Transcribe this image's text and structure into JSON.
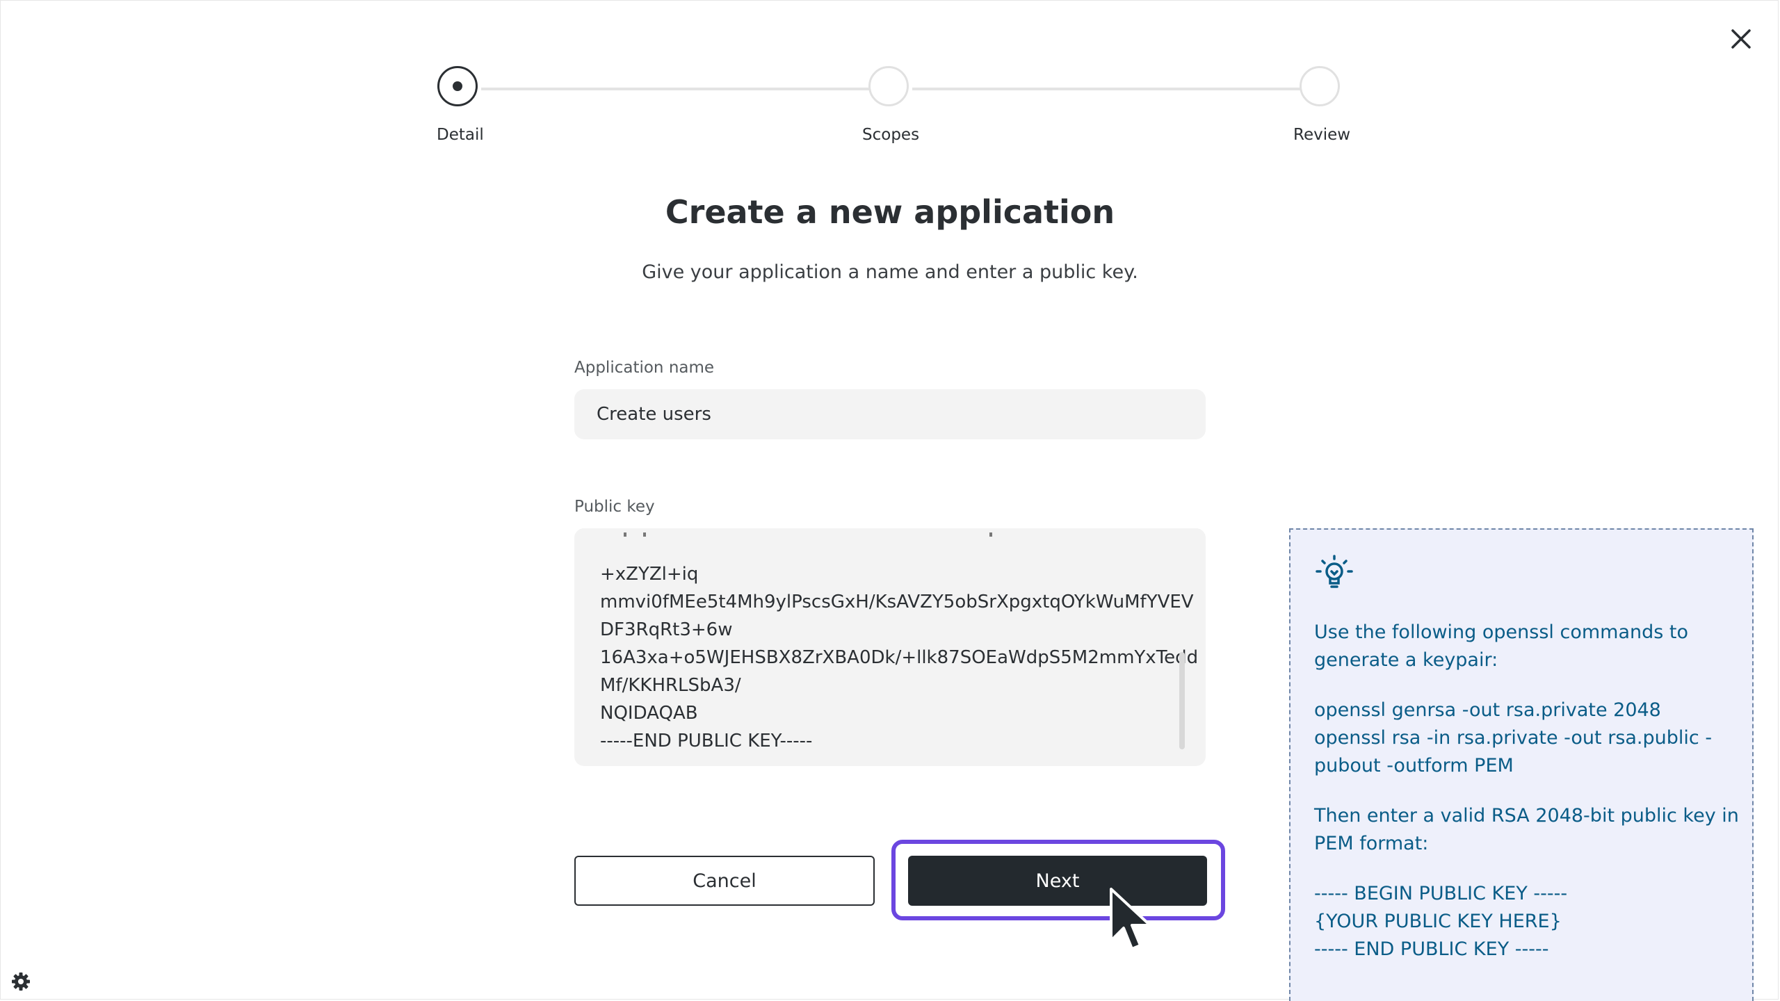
{
  "stepper": {
    "steps": [
      {
        "label": "Detail",
        "state": "active"
      },
      {
        "label": "Scopes",
        "state": "inactive"
      },
      {
        "label": "Review",
        "state": "inactive"
      }
    ]
  },
  "header": {
    "title": "Create a new application",
    "subtitle": "Give your application a name and enter a public key."
  },
  "form": {
    "app_name_label": "Application name",
    "app_name_value": "Create users",
    "public_key_label": "Public key",
    "public_key_lines": [
      "+xZYZl+iq",
      "mmvi0fMEe5t4Mh9ylPscsGxH/KsAVZY5obSrXpgxtqOYkWuMfYVEV",
      "DF3RqRt3+6w",
      "16A3xa+o5WJEHSBX8ZrXBA0Dk/+llk87SOEaWdpS5M2mmYxTedd",
      "Mf/KKHRLSbA3/",
      "NQIDAQAB",
      "-----END PUBLIC KEY-----"
    ]
  },
  "buttons": {
    "cancel": "Cancel",
    "next": "Next"
  },
  "tip": {
    "intro": "Use the following openssl commands to\ngenerate a keypair:",
    "commands": "openssl genrsa -out rsa.private 2048\nopenssl rsa -in rsa.private -out rsa.public -\npubout -outform PEM",
    "instruction": "Then enter a valid RSA 2048-bit public key in\nPEM format:",
    "template": "----- BEGIN PUBLIC KEY -----\n{YOUR PUBLIC KEY HERE}\n----- END PUBLIC KEY -----"
  },
  "colors": {
    "primary": "#23292e",
    "focus": "#6b46e0",
    "tip_text": "#0a5c87",
    "tip_bg": "#eef0fb"
  },
  "icons": {
    "close": "close-icon",
    "tip": "lightbulb-icon",
    "settings": "gear-icon",
    "cursor": "mouse-pointer-icon"
  }
}
